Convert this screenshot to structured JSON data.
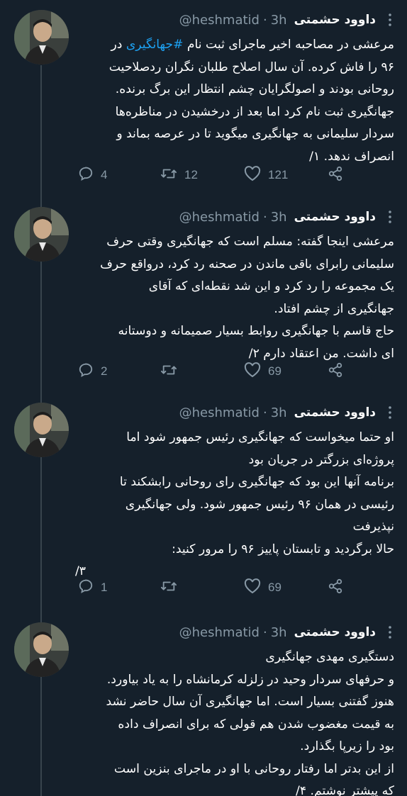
{
  "tweets": [
    {
      "name": "داوود حشمتی",
      "handle": "@heshmatid",
      "time": "3h",
      "lines": [
        {
          "before": "مرعشی در مصاحبه اخیر ماجرای ثبت نام ",
          "hashtag": "#جهانگیری",
          "after": " در"
        },
        {
          "before": "۹۶ را فاش کرده. آن سال اصلاح طلبان نگران ردصلاحیت"
        },
        {
          "before": "روحانی بودند و اصولگرایان چشم انتظار این برگ برنده."
        },
        {
          "before": "جهانگیری ثبت نام کرد اما بعد از درخشیدن در مناظره‌ها"
        },
        {
          "before": "سردار سلیمانی به جهانگیری میگوید تا در عرصه بماند و"
        },
        {
          "before": "انصراف ندهد. ۱/"
        }
      ],
      "replies": "4",
      "retweets": "12",
      "likes": "121"
    },
    {
      "name": "داوود حشمتی",
      "handle": "@heshmatid",
      "time": "3h",
      "lines": [
        {
          "before": "مرعشی اینجا گفته: مسلم است که جهانگیری وقتی حرف"
        },
        {
          "before": "سلیمانی رابرای باقی ماندن در صحنه رد کرد، درواقع حرف"
        },
        {
          "before": "یک مجموعه را رد کرد و این شد نقطه‌ای که آقای"
        },
        {
          "before": "جهانگیری از چشم افتاد."
        },
        {
          "before": "حاج قاسم با جهانگیری روابط بسیار صمیمانه و دوستانه"
        },
        {
          "before": "ای داشت. من اعتقاد دارم  ۲/"
        }
      ],
      "replies": "2",
      "retweets": "",
      "likes": "69"
    },
    {
      "name": "داوود حشمتی",
      "handle": "@heshmatid",
      "time": "3h",
      "lines": [
        {
          "before": "او حتما میخواست که جهانگیری رئیس جمهور شود اما"
        },
        {
          "before": "پروژه‌ای بزرگتر در جریان بود"
        },
        {
          "before": "برنامه آنها این بود که جهانگیری رای روحانی رابشکند تا"
        },
        {
          "before": "رئیسی در همان ۹۶ رئیس جمهور شود. ولی جهانگیری"
        },
        {
          "before": "نپذیرفت"
        },
        {
          "before": "حالا برگردید و تابستان پاییز ۹۶ را مرور کنید:"
        },
        {
          "before": "۳/",
          "align": "left"
        }
      ],
      "replies": "1",
      "retweets": "",
      "likes": "69"
    },
    {
      "name": "داوود حشمتی",
      "handle": "@heshmatid",
      "time": "3h",
      "lines": [
        {
          "before": "دستگیری مهدی جهانگیری"
        },
        {
          "before": "و حرفهای سردار وحید در زلزله کرمانشاه را به یاد بیاورد."
        },
        {
          "before": "هنوز گفتنی بسیار است. اما جهانگیری آن سال حاضر نشد"
        },
        {
          "before": "به قیمت مغضوب شدن هم قولی که برای انصراف داده"
        },
        {
          "before": "بود را زیرپا بگذارد."
        },
        {
          "before": "از این بدتر اما رفتار روحانی با او در ماجرای بنزین است"
        },
        {
          "before": "که پیشتر نوشتم. ۴/"
        }
      ]
    }
  ],
  "colors": {
    "background": "#15202b",
    "text": "#ffffff",
    "muted": "#8899a6",
    "accent": "#1da1f2",
    "thread_line": "#38444d"
  },
  "icons": {
    "reply": "reply-icon",
    "retweet": "retweet-icon",
    "like": "heart-icon",
    "share": "share-icon",
    "more": "more-vertical-icon"
  }
}
